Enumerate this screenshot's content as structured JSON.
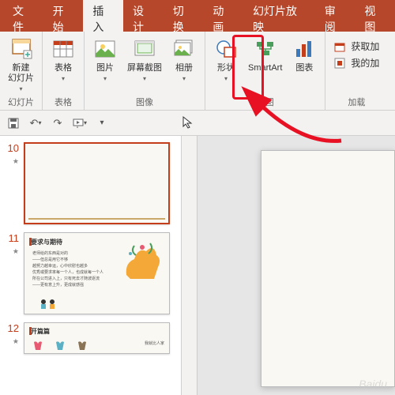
{
  "tabs": {
    "file": "文件",
    "home": "开始",
    "insert": "插入",
    "design": "设计",
    "transitions": "切换",
    "animations": "动画",
    "slideshow": "幻灯片放映",
    "review": "审阅",
    "view": "视图"
  },
  "ribbon": {
    "newSlide": "新建\n幻灯片",
    "table": "表格",
    "pictures": "图片",
    "screenshot": "屏幕截图",
    "album": "相册",
    "shapes": "形状",
    "smartart": "SmartArt",
    "chart": "图表",
    "getAddins": "获取加",
    "myAddins": "我的加",
    "groupSlides": "幻灯片",
    "groupTables": "表格",
    "groupImages": "图像",
    "groupIllustrations": "插图",
    "groupAddins": "加载"
  },
  "thumbs": {
    "n10": "10",
    "n11": "11",
    "n12": "12",
    "slide11Title": "要求与期待",
    "slide12Title": "开篇篇"
  },
  "watermark": "Baidu"
}
